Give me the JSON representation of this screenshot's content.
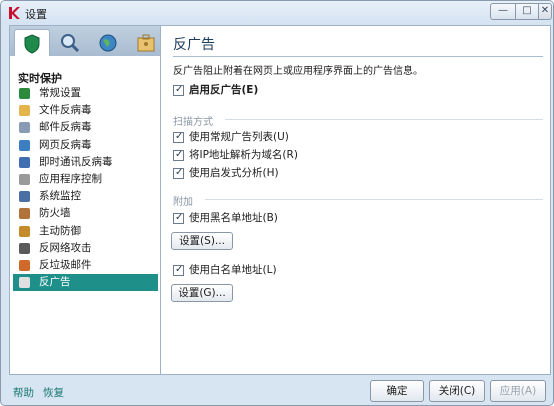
{
  "window": {
    "title": "设置"
  },
  "nav": {
    "section_title": "实时保护",
    "items": [
      {
        "label": "常规设置",
        "icon": "shield-icon",
        "color": "#2c8a3c"
      },
      {
        "label": "文件反病毒",
        "icon": "folder-icon",
        "color": "#e3b54b"
      },
      {
        "label": "邮件反病毒",
        "icon": "mail-icon",
        "color": "#8a9bb5"
      },
      {
        "label": "网页反病毒",
        "icon": "globe-icon",
        "color": "#3b7fc2"
      },
      {
        "label": "即时通讯反病毒",
        "icon": "chat-icon",
        "color": "#3f6fb0"
      },
      {
        "label": "应用程序控制",
        "icon": "funnel-icon",
        "color": "#9a9a9a"
      },
      {
        "label": "系统监控",
        "icon": "monitor-icon",
        "color": "#4a6fa5"
      },
      {
        "label": "防火墙",
        "icon": "firewall-icon",
        "color": "#b0733a"
      },
      {
        "label": "主动防御",
        "icon": "defense-icon",
        "color": "#c58b2a"
      },
      {
        "label": "反网络攻击",
        "icon": "network-attack-icon",
        "color": "#5a5a5a"
      },
      {
        "label": "反垃圾邮件",
        "icon": "spam-icon",
        "color": "#d06a2a"
      },
      {
        "label": "反广告",
        "icon": "anti-banner-icon",
        "color": "#e0e0e0"
      }
    ],
    "selected_index": 11
  },
  "panel": {
    "title": "反广告",
    "description": "反广告阻止附着在网页上或应用程序界面上的广告信息。",
    "enable_label": "启用反广告(E)",
    "scan_group": "扫描方式",
    "scan_options": [
      "使用常规广告列表(U)",
      "将IP地址解析为域名(R)",
      "使用启发式分析(H)"
    ],
    "extra_group": "附加",
    "blacklist_label": "使用黑名单地址(B)",
    "blacklist_button": "设置(S)...",
    "whitelist_label": "使用白名单地址(L)",
    "whitelist_button": "设置(G)..."
  },
  "footer": {
    "help": "帮助",
    "restore": "恢复",
    "ok": "确定",
    "close": "关闭(C)",
    "apply": "应用(A)"
  }
}
